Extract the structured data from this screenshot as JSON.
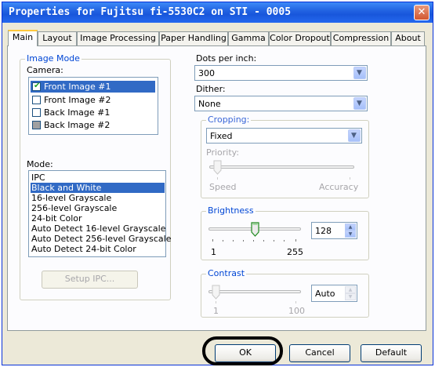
{
  "window": {
    "title": "Properties for Fujitsu fi-5530C2 on STI - 0005",
    "close_glyph": "✕"
  },
  "tabs": [
    {
      "label": "Main"
    },
    {
      "label": "Layout"
    },
    {
      "label": "Image Processing"
    },
    {
      "label": "Paper Handling"
    },
    {
      "label": "Gamma"
    },
    {
      "label": "Color Dropout"
    },
    {
      "label": "Compression"
    },
    {
      "label": "About"
    }
  ],
  "image_mode": {
    "group_label": "Image Mode",
    "camera_label": "Camera:",
    "camera_items": [
      {
        "label": "Front Image #1",
        "checked": true,
        "selected": true
      },
      {
        "label": "Front Image #2",
        "checked": false,
        "selected": false
      },
      {
        "label": "Back Image #1",
        "checked": false,
        "selected": false
      },
      {
        "label": "Back Image #2",
        "checked": false,
        "selected": false
      }
    ],
    "mode_label": "Mode:",
    "mode_items": [
      "IPC",
      "Black and White",
      "16-level Grayscale",
      "256-level Grayscale",
      "24-bit Color",
      "Auto Detect 16-level Grayscale",
      "Auto Detect 256-level Grayscale",
      "Auto Detect 24-bit Color"
    ],
    "mode_selected_index": 1,
    "setup_button": "Setup IPC..."
  },
  "dpi": {
    "label": "Dots per inch:",
    "value": "300"
  },
  "dither": {
    "label": "Dither:",
    "value": "None"
  },
  "cropping": {
    "group_label": "Cropping:",
    "value": "Fixed",
    "priority_label": "Priority:",
    "min_label": "Speed",
    "max_label": "Accuracy"
  },
  "brightness": {
    "group_label": "Brightness",
    "value": "128",
    "min_label": "1",
    "max_label": "255",
    "level": 128
  },
  "contrast": {
    "group_label": "Contrast",
    "value": "Auto",
    "min_label": "1",
    "max_label": "100"
  },
  "buttons": {
    "ok": "OK",
    "cancel": "Cancel",
    "default": "Default"
  },
  "colors": {
    "title_bar": "#1f5fe0",
    "selection": "#316ac5",
    "group_label": "#0046d5"
  }
}
